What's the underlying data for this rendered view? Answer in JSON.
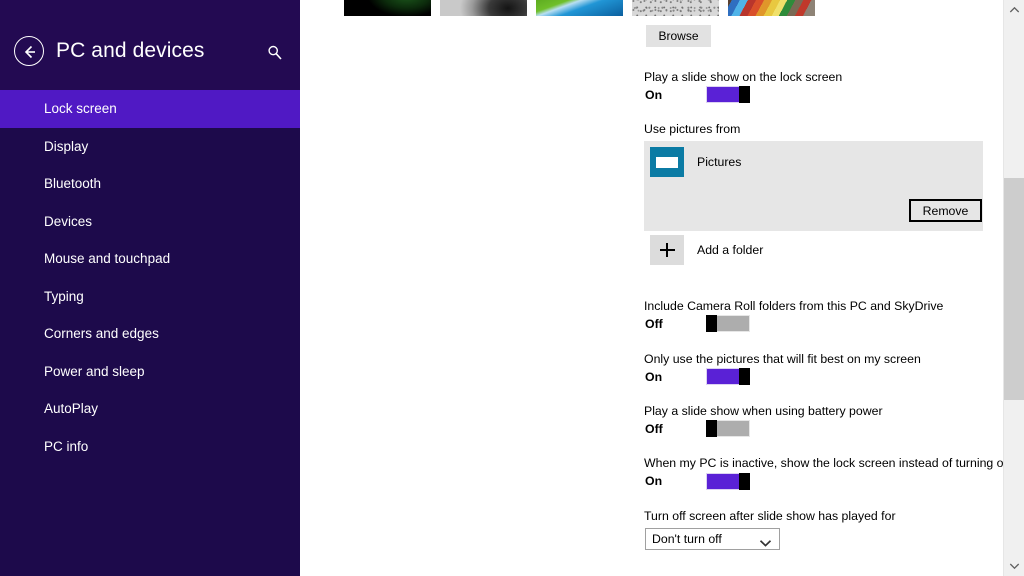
{
  "header": {
    "title": "PC and devices",
    "back_icon": "back-arrow-icon",
    "search_icon": "search-icon"
  },
  "sidebar": {
    "items": [
      {
        "label": "Lock screen",
        "selected": true
      },
      {
        "label": "Display",
        "selected": false
      },
      {
        "label": "Bluetooth",
        "selected": false
      },
      {
        "label": "Devices",
        "selected": false
      },
      {
        "label": "Mouse and touchpad",
        "selected": false
      },
      {
        "label": "Typing",
        "selected": false
      },
      {
        "label": "Corners and edges",
        "selected": false
      },
      {
        "label": "Power and sleep",
        "selected": false
      },
      {
        "label": "AutoPlay",
        "selected": false
      },
      {
        "label": "PC info",
        "selected": false
      }
    ],
    "selected_bg": "#5019c4",
    "bg": "#1d0a4b"
  },
  "main": {
    "thumbnails": [
      {
        "name": "lock-screen-thumb-1"
      },
      {
        "name": "lock-screen-thumb-2"
      },
      {
        "name": "lock-screen-thumb-3"
      },
      {
        "name": "lock-screen-thumb-4"
      },
      {
        "name": "lock-screen-thumb-5"
      }
    ],
    "browse_label": "Browse",
    "slideshow": {
      "label": "Play a slide show on the lock screen",
      "state": "On",
      "on": true
    },
    "use_pictures_from": {
      "label": "Use pictures from",
      "folder_name": "Pictures",
      "remove_label": "Remove",
      "add_folder_label": "Add a folder"
    },
    "camera_roll": {
      "label": "Include Camera Roll folders from this PC and SkyDrive",
      "state": "Off",
      "on": false
    },
    "fit_best": {
      "label": "Only use the pictures that will fit best on my screen",
      "state": "On",
      "on": true
    },
    "battery_power": {
      "label": "Play a slide show when using battery power",
      "state": "Off",
      "on": false
    },
    "inactive_lock": {
      "label": "When my PC is inactive, show the lock screen instead of turning off the screen",
      "state": "On",
      "on": true
    },
    "turn_off_screen": {
      "label": "Turn off screen after slide show has played for",
      "value": "Don't turn off"
    }
  },
  "scrollbar": {
    "up_icon": "chevron-up-icon",
    "down_icon": "chevron-down-icon"
  },
  "colors": {
    "accent_purple": "#5a21d6",
    "header_purple": "#230a52",
    "folder_icon_teal": "#0b7ba4"
  }
}
